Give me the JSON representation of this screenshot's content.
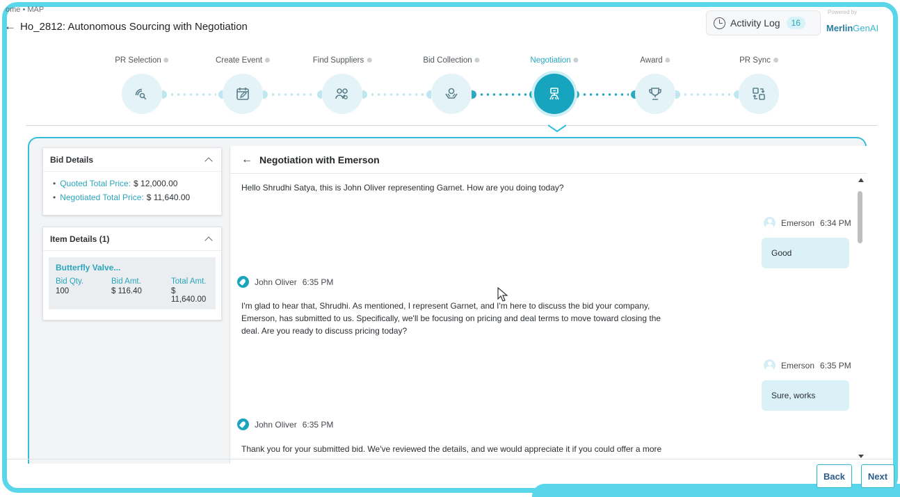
{
  "breadcrumb": "ome  •  MAP",
  "page": {
    "title": "Ho_2812: Autonomous Sourcing with Negotiation"
  },
  "activity": {
    "label": "Activity Log",
    "count": "16"
  },
  "powered": {
    "caption": "Powered by",
    "brand_main": "Merlin",
    "brand_ai": "GenAI"
  },
  "stepper": {
    "active_index": 4,
    "steps": [
      {
        "label": "PR Selection",
        "icon": "radar-search-icon"
      },
      {
        "label": "Create Event",
        "icon": "calendar-edit-icon"
      },
      {
        "label": "Find Suppliers",
        "icon": "people-search-icon"
      },
      {
        "label": "Bid Collection",
        "icon": "hand-coin-icon"
      },
      {
        "label": "Negotiation",
        "icon": "negotiation-icon"
      },
      {
        "label": "Award",
        "icon": "trophy-icon"
      },
      {
        "label": "PR Sync",
        "icon": "sync-icon"
      }
    ]
  },
  "bid_details": {
    "title": "Bid Details",
    "quoted_label": "Quoted Total Price:",
    "quoted_value": "$ 12,000.00",
    "negotiated_label": "Negotiated Total Price:",
    "negotiated_value": "$ 11,640.00"
  },
  "item_details": {
    "title": "Item Details (1)",
    "item_name": "Butterfly Valve...",
    "col_qty": "Bid Qty.",
    "col_amt": "Bid Amt.",
    "col_total": "Total Amt.",
    "qty": "100",
    "amt": "$ 116.40",
    "total": "$ 11,640.00"
  },
  "chat": {
    "title": "Negotiation with Emerson",
    "m1": "Hello Shrudhi Satya, this is John Oliver representing Garnet. How are you doing today?",
    "r1_sender": "Emerson",
    "r1_time": "6:34 PM",
    "r1_text": "Good",
    "b1_sender": "John Oliver",
    "b1_time": "6:35 PM",
    "b1_line1": "I'm glad to hear that, Shrudhi. As mentioned, I represent Garnet, and I'm here to discuss the bid your company,",
    "b1_line2": "Emerson, has submitted to us. Specifically, we'll be focusing on pricing and deal terms to move toward closing the",
    "b1_line3": "deal. Are you ready to discuss pricing today?",
    "r2_sender": "Emerson",
    "r2_time": "6:35 PM",
    "r2_text": "Sure, works",
    "b2_sender": "John Oliver",
    "b2_time": "6:35 PM",
    "b2_line1": "Thank you for your submitted bid. We've reviewed the details, and we would appreciate it if you could offer a more"
  },
  "footer": {
    "back": "Back",
    "next": "Next"
  },
  "colors": {
    "accent": "#17a4be",
    "frame": "#5ad6ea",
    "bubble": "#daf2f7"
  }
}
